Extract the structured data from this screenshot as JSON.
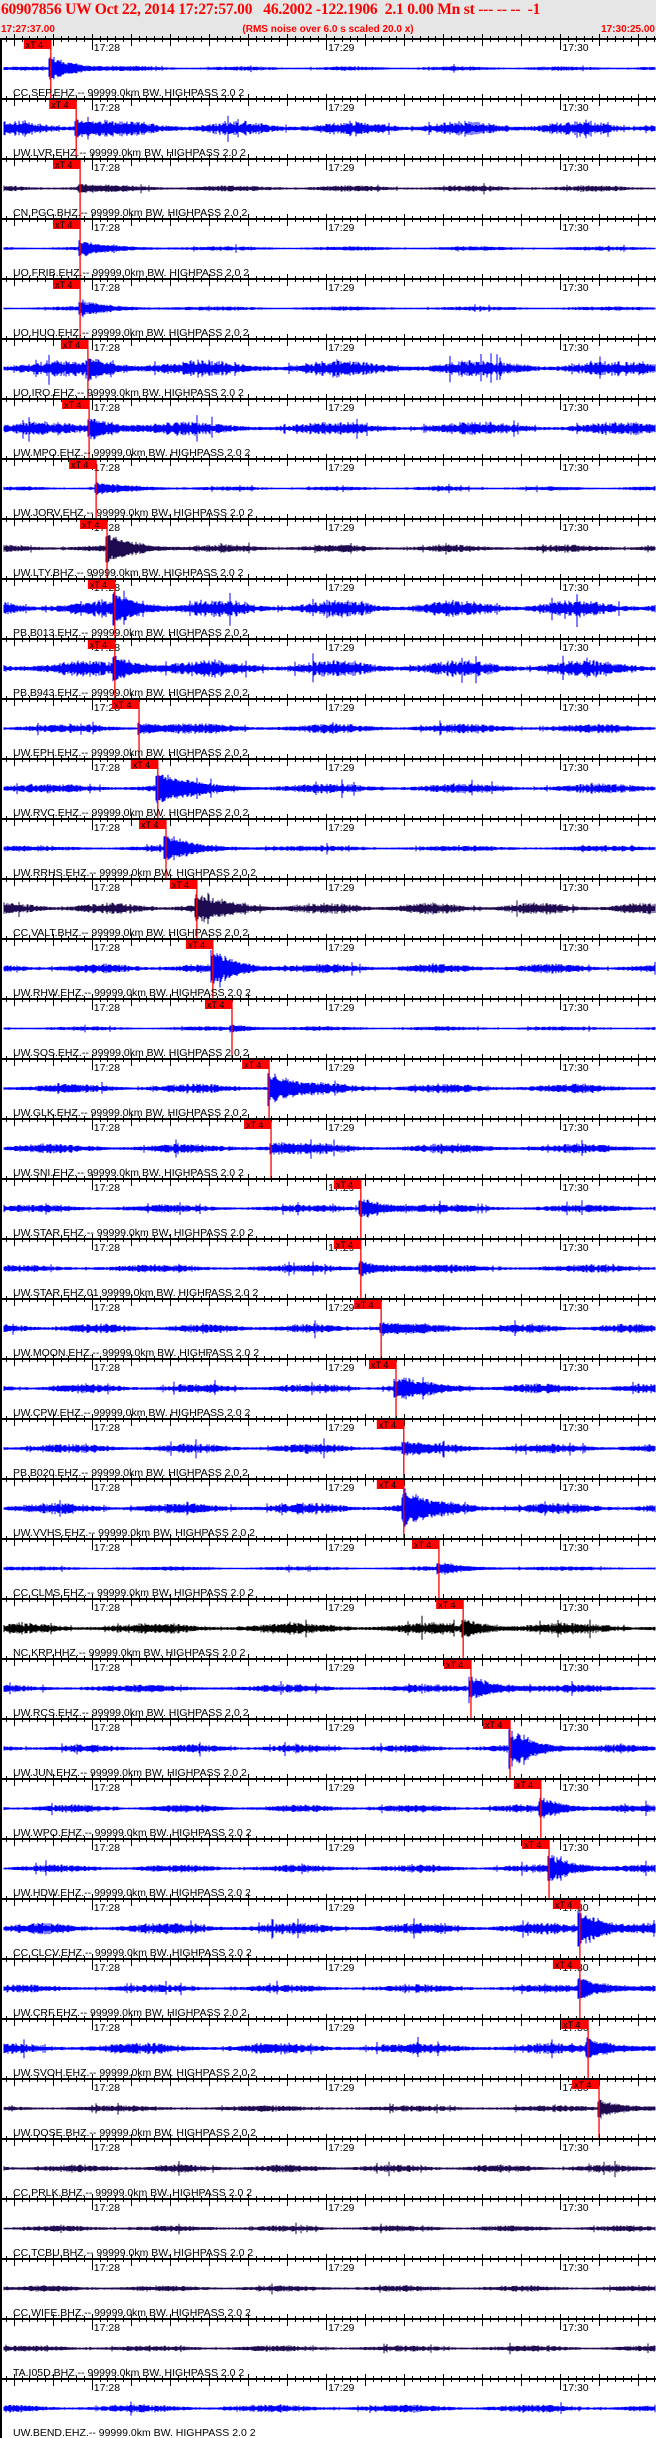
{
  "header": {
    "title": "60907856 UW Oct 22, 2014 17:27:57.00   46.2002 -122.1906  2.1 0.00 Mn st --- -- --  -1",
    "start_time": "17:27:37.00",
    "rms_note": "(RMS noise over 6.0 s scaled 20.0 x)",
    "end_time": "17:30:25.00"
  },
  "chart_data": {
    "type": "line",
    "title": "60907856 UW Oct 22, 2014 17:27:57.00",
    "x_start": "17:27:37.00",
    "x_end": "17:30:25.00",
    "duration_s": 168,
    "time_labels": [
      {
        "label": "17:28",
        "t": 23
      },
      {
        "label": "17:29",
        "t": 83
      },
      {
        "label": "17:30",
        "t": 143
      }
    ],
    "pick_label": "xT 4",
    "colors": {
      "ehz": "#0000ff",
      "bhz": "#1e0a50",
      "hhz": "#000000",
      "pick": "#ff0000"
    },
    "traces": [
      {
        "label": "CC.SEP.EHZ.-- 99999.0km BW. HIGHPASS  2.0  2",
        "color": "#0000ff",
        "pick_s": 12.5,
        "noise_level": 2,
        "event_level": 14
      },
      {
        "label": "UW.LVR.EHZ.-- 99999.0km BW. HIGHPASS  2.0  2",
        "color": "#0000ff",
        "pick_s": 19.0,
        "noise_level": 8,
        "event_level": 10
      },
      {
        "label": "CN.PGC.BHZ.-- 99999.0km BW. HIGHPASS  2.0  2",
        "color": "#1e0a50",
        "pick_s": 20.0,
        "noise_level": 3,
        "event_level": 4
      },
      {
        "label": "UO.FRIB.EHZ.-- 99999.0km BW. HIGHPASS  2.0  2",
        "color": "#0000ff",
        "pick_s": 20.0,
        "noise_level": 2,
        "event_level": 8
      },
      {
        "label": "UO.HUO.EHZ.-- 99999.0km BW. HIGHPASS  2.0  2",
        "color": "#0000ff",
        "pick_s": 20.0,
        "noise_level": 2,
        "event_level": 8
      },
      {
        "label": "UO.IRO.EHZ.-- 99999.0km BW. HIGHPASS  2.0  2",
        "color": "#0000ff",
        "pick_s": 22.0,
        "noise_level": 9,
        "event_level": 8
      },
      {
        "label": "UW.MPO.EHZ.-- 99999.0km BW. HIGHPASS  2.0  2",
        "color": "#0000ff",
        "pick_s": 22.3,
        "noise_level": 7,
        "event_level": 12
      },
      {
        "label": "UW.JORV.EHZ.-- 99999.0km BW. HIGHPASS  2.0  2",
        "color": "#0000ff",
        "pick_s": 24.1,
        "noise_level": 2,
        "event_level": 6
      },
      {
        "label": "UW.LTY.BHZ.-- 99999.0km BW. HIGHPASS  2.0  2",
        "color": "#1e0a50",
        "pick_s": 26.9,
        "noise_level": 4,
        "event_level": 14
      },
      {
        "label": "PB.B013.EHZ.-- 99999.0km BW. HIGHPASS  2.0  2",
        "color": "#0000ff",
        "pick_s": 28.9,
        "noise_level": 9,
        "event_level": 12
      },
      {
        "label": "PB.B943.EHZ.-- 99999.0km BW. HIGHPASS  2.0  2",
        "color": "#0000ff",
        "pick_s": 28.9,
        "noise_level": 9,
        "event_level": 12
      },
      {
        "label": "UW.EPH.EHZ.-- 99999.0km BW. HIGHPASS  2.0  2",
        "color": "#0000ff",
        "pick_s": 35.1,
        "noise_level": 5,
        "event_level": 6
      },
      {
        "label": "UW.RVC.EHZ.-- 99999.0km BW. HIGHPASS  2.0  2",
        "color": "#0000ff",
        "pick_s": 39.9,
        "noise_level": 5,
        "event_level": 18
      },
      {
        "label": "UW.RRHS.EHZ.-- 99999.0km BW. HIGHPASS  2.0  2",
        "color": "#0000ff",
        "pick_s": 42.0,
        "noise_level": 3,
        "event_level": 14
      },
      {
        "label": "CC.VALT.BHZ.-- 99999.0km BW. HIGHPASS  2.0  2",
        "color": "#1e0a50",
        "pick_s": 49.9,
        "noise_level": 6,
        "event_level": 14
      },
      {
        "label": "UW.RHW.EHZ.-- 99999.0km BW. HIGHPASS  2.0  2",
        "color": "#0000ff",
        "pick_s": 54.0,
        "noise_level": 5,
        "event_level": 16
      },
      {
        "label": "UW.SOS.EHZ.-- 99999.0km BW. HIGHPASS  2.0  2",
        "color": "#0000ff",
        "pick_s": 58.9,
        "noise_level": 2,
        "event_level": 3
      },
      {
        "label": "UW.GLK.EHZ.-- 99999.0km BW. HIGHPASS  2.0  2",
        "color": "#0000ff",
        "pick_s": 68.4,
        "noise_level": 5,
        "event_level": 18
      },
      {
        "label": "UW.SNI.EHZ.-- 99999.0km BW. HIGHPASS  2.0  2",
        "color": "#0000ff",
        "pick_s": 68.9,
        "noise_level": 5,
        "event_level": 6
      },
      {
        "label": "UW.STAR.EHZ.-- 99999.0km BW. HIGHPASS  2.0  2",
        "color": "#0000ff",
        "pick_s": 91.9,
        "noise_level": 4,
        "event_level": 12
      },
      {
        "label": "UW.STAR.EHZ.01 99999.0km BW. HIGHPASS  2.0  2",
        "color": "#0000ff",
        "pick_s": 91.9,
        "noise_level": 4,
        "event_level": 8
      },
      {
        "label": "UW.MOON.EHZ.-- 99999.0km BW. HIGHPASS  2.0  2",
        "color": "#0000ff",
        "pick_s": 97.1,
        "noise_level": 5,
        "event_level": 6
      },
      {
        "label": "UW.CPW.EHZ.-- 99999.0km BW. HIGHPASS  2.0  2",
        "color": "#0000ff",
        "pick_s": 100.9,
        "noise_level": 5,
        "event_level": 12
      },
      {
        "label": "PB.B020.EHZ.-- 99999.0km BW. HIGHPASS  2.0  2",
        "color": "#0000ff",
        "pick_s": 102.9,
        "noise_level": 5,
        "event_level": 5
      },
      {
        "label": "UW.VVHS.EHZ.-- 99999.0km BW. HIGHPASS  2.0  2",
        "color": "#0000ff",
        "pick_s": 102.9,
        "noise_level": 6,
        "event_level": 18
      },
      {
        "label": "CC.CLMS.EHZ.-- 99999.0km BW. HIGHPASS  2.0  2",
        "color": "#0000ff",
        "pick_s": 111.9,
        "noise_level": 2,
        "event_level": 6
      },
      {
        "label": "NC.KRP.HHZ.-- 99999.0km BW. HIGHPASS  2.0  2",
        "color": "#000000",
        "pick_s": 118.1,
        "noise_level": 6,
        "event_level": 8
      },
      {
        "label": "UW.RCS.EHZ.-- 99999.0km BW. HIGHPASS  2.0  2",
        "color": "#0000ff",
        "pick_s": 120.1,
        "noise_level": 4,
        "event_level": 14
      },
      {
        "label": "UW.JUN.EHZ.-- 99999.0km BW. HIGHPASS  2.0  2",
        "color": "#0000ff",
        "pick_s": 130.1,
        "noise_level": 4,
        "event_level": 18
      },
      {
        "label": "UW.WPO.EHZ.-- 99999.0km BW. HIGHPASS  2.0  2",
        "color": "#0000ff",
        "pick_s": 138.0,
        "noise_level": 4,
        "event_level": 10
      },
      {
        "label": "UW.HDW.EHZ.-- 99999.0km BW. HIGHPASS  2.0  2",
        "color": "#0000ff",
        "pick_s": 140.1,
        "noise_level": 4,
        "event_level": 14
      },
      {
        "label": "CC.CLCV.EHZ.-- 99999.0km BW. HIGHPASS  2.0  2",
        "color": "#0000ff",
        "pick_s": 148.0,
        "noise_level": 6,
        "event_level": 20
      },
      {
        "label": "UW.CRF.EHZ.-- 99999.0km BW. HIGHPASS  2.0  2",
        "color": "#0000ff",
        "pick_s": 148.0,
        "noise_level": 4,
        "event_level": 12
      },
      {
        "label": "UW.SVOH.EHZ.-- 99999.0km BW. HIGHPASS  2.0  2",
        "color": "#0000ff",
        "pick_s": 150.1,
        "noise_level": 6,
        "event_level": 10
      },
      {
        "label": "UW.DOSE.BHZ.-- 99999.0km BW. HIGHPASS  2.0  2",
        "color": "#1e0a50",
        "pick_s": 152.9,
        "noise_level": 3,
        "event_level": 10
      },
      {
        "label": "CC.PRLK.BHZ.-- 99999.0km BW. HIGHPASS  2.0  2",
        "color": "#1e0a50",
        "pick_s": null,
        "noise_level": 4,
        "event_level": 0
      },
      {
        "label": "CC.TCBU.BHZ.-- 99999.0km BW. HIGHPASS  2.0  2",
        "color": "#1e0a50",
        "pick_s": null,
        "noise_level": 3,
        "event_level": 0
      },
      {
        "label": "CC.WIFE.BHZ.-- 99999.0km BW. HIGHPASS  2.0  2",
        "color": "#1e0a50",
        "pick_s": null,
        "noise_level": 3,
        "event_level": 0
      },
      {
        "label": "TA.I05D.BHZ.-- 99999.0km BW. HIGHPASS  2.0  2",
        "color": "#1e0a50",
        "pick_s": null,
        "noise_level": 3,
        "event_level": 0
      },
      {
        "label": "UW.BEND.EHZ.-- 99999.0km BW. HIGHPASS  2.0  2",
        "color": "#0000ff",
        "pick_s": null,
        "noise_level": 4,
        "event_level": 0
      }
    ]
  }
}
